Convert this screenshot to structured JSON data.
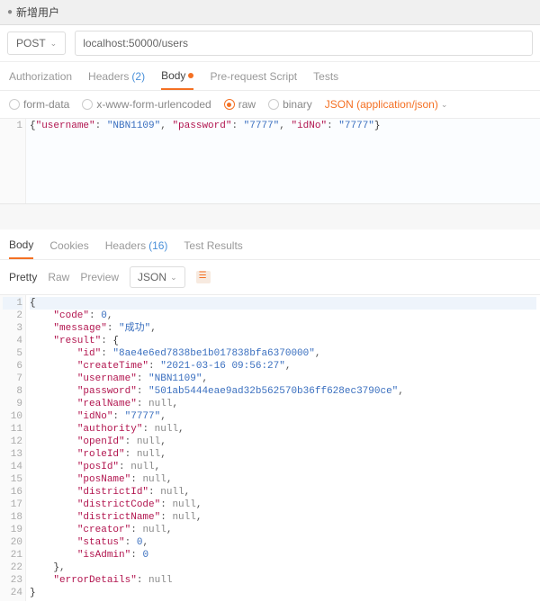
{
  "titlebar": {
    "bullet": "●",
    "name": "新增用户"
  },
  "request": {
    "method": "POST",
    "url": "localhost:50000/users"
  },
  "reqTabs": {
    "auth": "Authorization",
    "headers": "Headers",
    "headersCount": "(2)",
    "body": "Body",
    "preq": "Pre-request Script",
    "tests": "Tests"
  },
  "bodyOpts": {
    "formdata": "form-data",
    "xwww": "x-www-form-urlencoded",
    "raw": "raw",
    "binary": "binary",
    "ctype": "JSON (application/json)"
  },
  "reqGutter": "1",
  "reqKeys": {
    "username": "\"username\"",
    "password": "\"password\"",
    "idNo": "\"idNo\""
  },
  "reqVals": {
    "username": "\"NBN1109\"",
    "password": "\"7777\"",
    "idNo": "\"7777\""
  },
  "respTabs": {
    "body": "Body",
    "cookies": "Cookies",
    "headers": "Headers",
    "headersCount": "(16)",
    "tests": "Test Results"
  },
  "view": {
    "pretty": "Pretty",
    "raw": "Raw",
    "preview": "Preview",
    "json": "JSON"
  },
  "gut": [
    "1",
    "2",
    "3",
    "4",
    "5",
    "6",
    "7",
    "8",
    "9",
    "10",
    "11",
    "12",
    "13",
    "14",
    "15",
    "16",
    "17",
    "18",
    "19",
    "20",
    "21",
    "22",
    "23",
    "24"
  ],
  "r": {
    "code_k": "\"code\"",
    "code_v": "0",
    "message_k": "\"message\"",
    "message_v": "\"成功\"",
    "result_k": "\"result\"",
    "id_k": "\"id\"",
    "id_v": "\"8ae4e6ed7838be1b017838bfa6370000\"",
    "createTime_k": "\"createTime\"",
    "createTime_v": "\"2021-03-16 09:56:27\"",
    "username_k": "\"username\"",
    "username_v": "\"NBN1109\"",
    "password_k": "\"password\"",
    "password_v": "\"501ab5444eae9ad32b562570b36ff628ec3790ce\"",
    "realName_k": "\"realName\"",
    "idNo_k": "\"idNo\"",
    "idNo_v": "\"7777\"",
    "authority_k": "\"authority\"",
    "openId_k": "\"openId\"",
    "roleId_k": "\"roleId\"",
    "posId_k": "\"posId\"",
    "posName_k": "\"posName\"",
    "districtId_k": "\"districtId\"",
    "districtCode_k": "\"districtCode\"",
    "districtName_k": "\"districtName\"",
    "creator_k": "\"creator\"",
    "status_k": "\"status\"",
    "status_v": "0",
    "isAdmin_k": "\"isAdmin\"",
    "isAdmin_v": "0",
    "errorDetails_k": "\"errorDetails\"",
    "null": "null"
  }
}
